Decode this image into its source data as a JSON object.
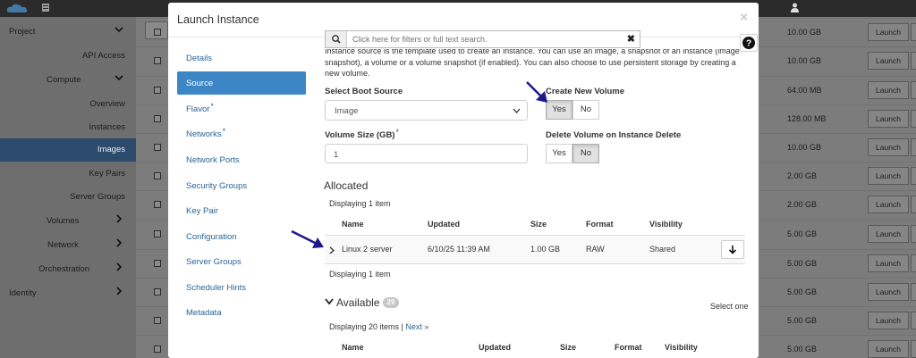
{
  "sidebar": {
    "items": [
      {
        "label": "Project"
      },
      {
        "label": "API Access"
      },
      {
        "label": "Compute"
      },
      {
        "label": "Overview"
      },
      {
        "label": "Instances"
      },
      {
        "label": "Images"
      },
      {
        "label": "Key Pairs"
      },
      {
        "label": "Server Groups"
      },
      {
        "label": "Volumes"
      },
      {
        "label": "Network"
      },
      {
        "label": "Orchestration"
      },
      {
        "label": "Identity"
      }
    ]
  },
  "background_table": {
    "launch_label": "Launch",
    "sizes": [
      "10.00 GB",
      "10.00 GB",
      "64.00 MB",
      "128.00 MB",
      "10.00 GB",
      "2.00 GB",
      "2.00 GB",
      "5.00 GB",
      "5.00 GB",
      "5.00 GB",
      "5.00 GB",
      "5.00 GB"
    ]
  },
  "modal": {
    "title": "Launch Instance",
    "close": "×",
    "nav": [
      {
        "label": "Details",
        "required": false
      },
      {
        "label": "Source",
        "required": false
      },
      {
        "label": "Flavor",
        "required": true
      },
      {
        "label": "Networks",
        "required": true
      },
      {
        "label": "Network Ports",
        "required": false
      },
      {
        "label": "Security Groups",
        "required": false
      },
      {
        "label": "Key Pair",
        "required": false
      },
      {
        "label": "Configuration",
        "required": false
      },
      {
        "label": "Server Groups",
        "required": false
      },
      {
        "label": "Scheduler Hints",
        "required": false
      },
      {
        "label": "Metadata",
        "required": false
      }
    ],
    "required_marker": "*",
    "filter": {
      "placeholder": "Click here for filters or full text search.",
      "clear": "✖"
    },
    "intro": "Instance source is the template used to create an instance. You can use an image, a snapshot of an instance (image snapshot), a volume or a volume snapshot (if enabled). You can also choose to use persistent storage by creating a new volume.",
    "boot_source": {
      "label": "Select Boot Source",
      "value": "Image"
    },
    "create_volume": {
      "label": "Create New Volume",
      "yes": "Yes",
      "no": "No",
      "selected": "Yes"
    },
    "volume_size": {
      "label": "Volume Size (GB)",
      "value": "1"
    },
    "delete_volume": {
      "label": "Delete Volume on Instance Delete",
      "yes": "Yes",
      "no": "No",
      "selected": "No"
    },
    "allocated": {
      "title": "Allocated",
      "count_text": "Displaying 1 item",
      "columns": [
        "Name",
        "Updated",
        "Size",
        "Format",
        "Visibility"
      ],
      "rows": [
        {
          "name": "Linux 2 server",
          "updated": "6/10/25 11:39 AM",
          "size": "1.00 GB",
          "format": "RAW",
          "visibility": "Shared"
        }
      ],
      "footer_text": "Displaying 1 item"
    },
    "available": {
      "title": "Available",
      "count": "29",
      "select_one": "Select one",
      "display_text": "Displaying 20 items | ",
      "next_link": "Next »",
      "columns": [
        "Name",
        "Updated",
        "Size",
        "Format",
        "Visibility"
      ]
    }
  },
  "colors": {
    "accent": "#3c86c6",
    "link": "#2a6496",
    "annotation_arrow": "#1f1a8c"
  }
}
